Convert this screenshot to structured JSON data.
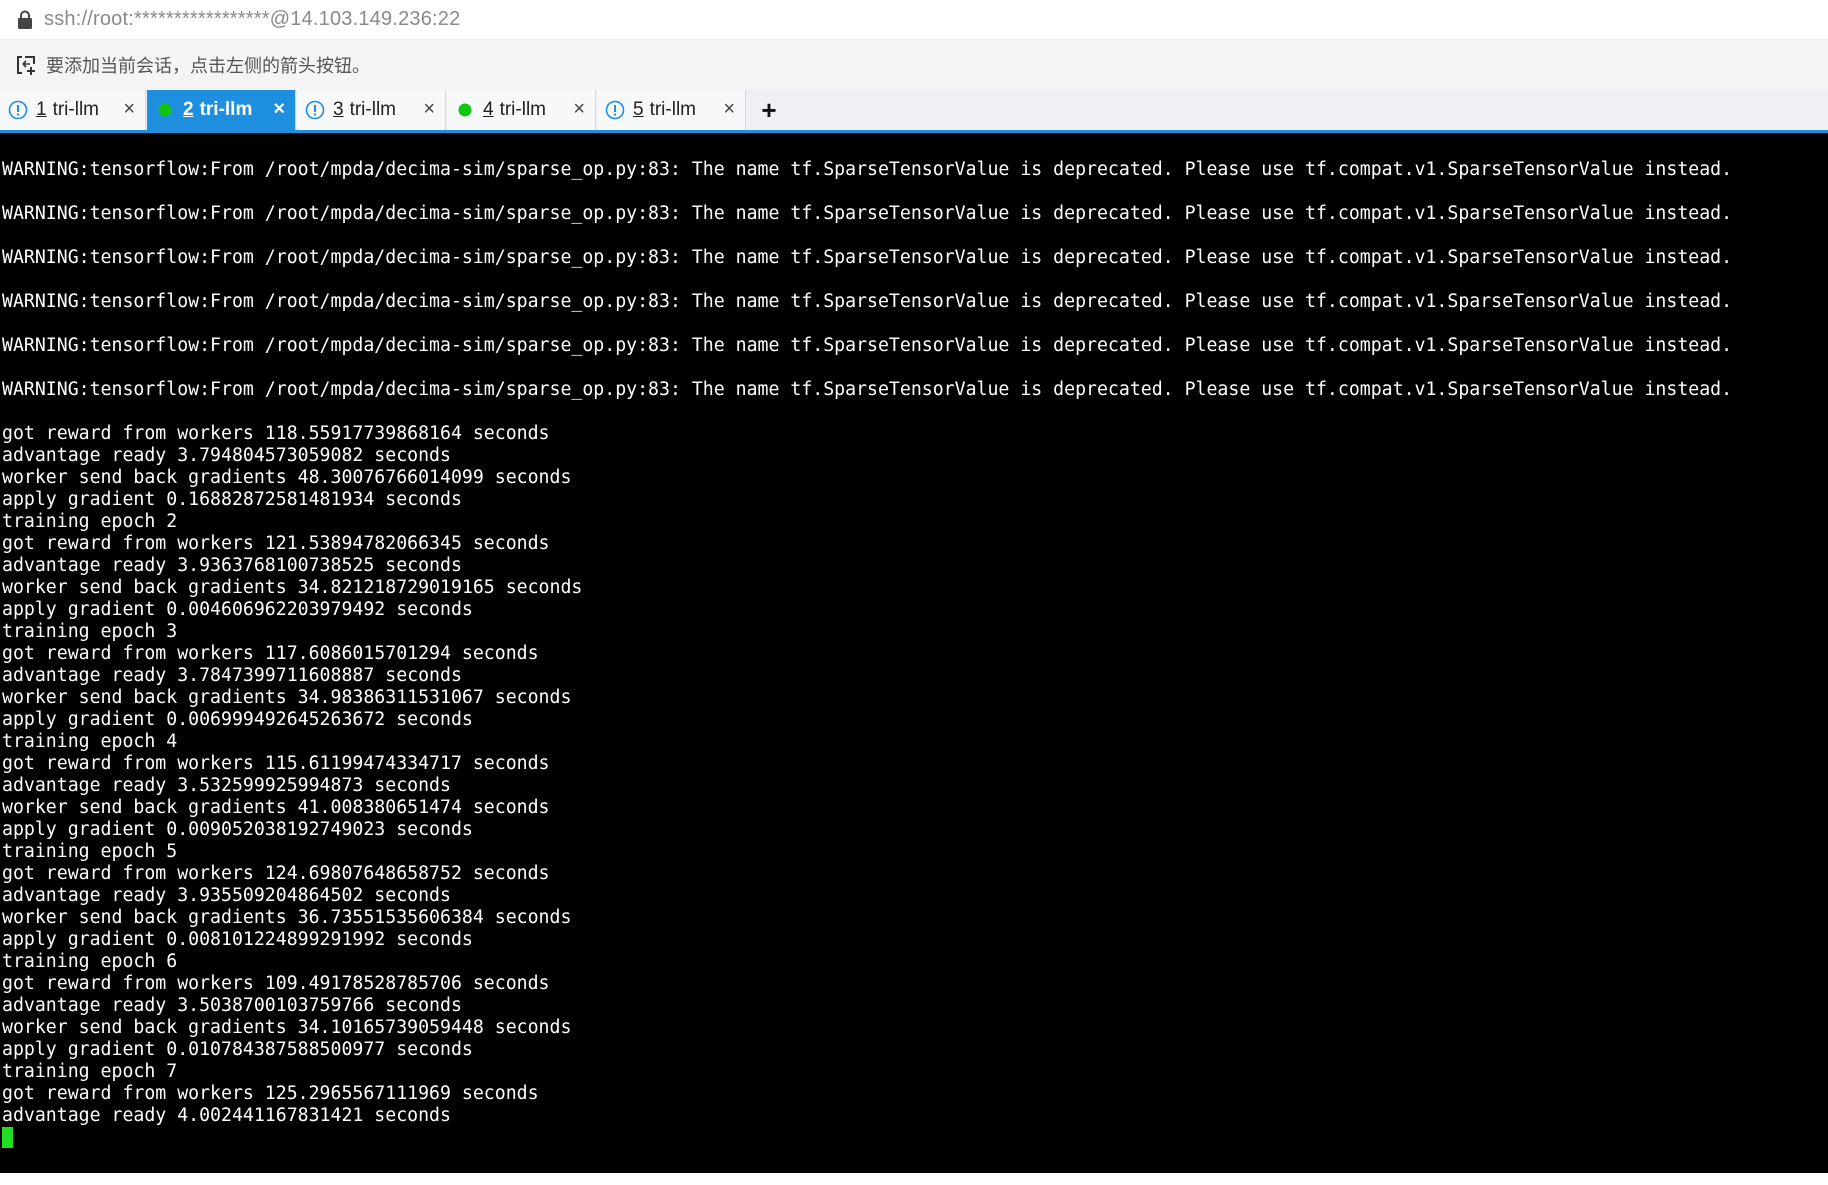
{
  "address": {
    "text": "ssh://root:*****************@14.103.149.236:22",
    "lock_icon": "lock-icon"
  },
  "hint": {
    "text": "要添加当前会话，点击左侧的箭头按钮。",
    "icon": "add-session-icon"
  },
  "tabs": [
    {
      "num": "1",
      "name": "tri-llm",
      "status": "warning",
      "active": false
    },
    {
      "num": "2",
      "name": "tri-llm",
      "status": "connected",
      "active": true
    },
    {
      "num": "3",
      "name": "tri-llm",
      "status": "warning",
      "active": false
    },
    {
      "num": "4",
      "name": "tri-llm",
      "status": "connected",
      "active": false
    },
    {
      "num": "5",
      "name": "tri-llm",
      "status": "warning",
      "active": false
    }
  ],
  "tab_close": "×",
  "new_tab": "+",
  "colors": {
    "accent": "#1e8fde",
    "connected": "#11c411",
    "warning": "#1e8fde",
    "cursor": "#22dd22"
  },
  "terminal": {
    "warnings": [
      "WARNING:tensorflow:From /root/mpda/decima-sim/sparse_op.py:83: The name tf.SparseTensorValue is deprecated. Please use tf.compat.v1.SparseTensorValue instead.",
      "WARNING:tensorflow:From /root/mpda/decima-sim/sparse_op.py:83: The name tf.SparseTensorValue is deprecated. Please use tf.compat.v1.SparseTensorValue instead.",
      "WARNING:tensorflow:From /root/mpda/decima-sim/sparse_op.py:83: The name tf.SparseTensorValue is deprecated. Please use tf.compat.v1.SparseTensorValue instead.",
      "WARNING:tensorflow:From /root/mpda/decima-sim/sparse_op.py:83: The name tf.SparseTensorValue is deprecated. Please use tf.compat.v1.SparseTensorValue instead.",
      "WARNING:tensorflow:From /root/mpda/decima-sim/sparse_op.py:83: The name tf.SparseTensorValue is deprecated. Please use tf.compat.v1.SparseTensorValue instead.",
      "WARNING:tensorflow:From /root/mpda/decima-sim/sparse_op.py:83: The name tf.SparseTensorValue is deprecated. Please use tf.compat.v1.SparseTensorValue instead."
    ],
    "output": [
      "got reward from workers 118.55917739868164 seconds",
      "advantage ready 3.794804573059082 seconds",
      "worker send back gradients 48.30076766014099 seconds",
      "apply gradient 0.16882872581481934 seconds",
      "training epoch 2",
      "got reward from workers 121.53894782066345 seconds",
      "advantage ready 3.9363768100738525 seconds",
      "worker send back gradients 34.821218729019165 seconds",
      "apply gradient 0.004606962203979492 seconds",
      "training epoch 3",
      "got reward from workers 117.6086015701294 seconds",
      "advantage ready 3.7847399711608887 seconds",
      "worker send back gradients 34.98386311531067 seconds",
      "apply gradient 0.006999492645263672 seconds",
      "training epoch 4",
      "got reward from workers 115.61199474334717 seconds",
      "advantage ready 3.532599925994873 seconds",
      "worker send back gradients 41.008380651474 seconds",
      "apply gradient 0.009052038192749023 seconds",
      "training epoch 5",
      "got reward from workers 124.69807648658752 seconds",
      "advantage ready 3.935509204864502 seconds",
      "worker send back gradients 36.73551535606384 seconds",
      "apply gradient 0.008101224899291992 seconds",
      "training epoch 6",
      "got reward from workers 109.49178528785706 seconds",
      "advantage ready 3.5038700103759766 seconds",
      "worker send back gradients 34.10165739059448 seconds",
      "apply gradient 0.010784387588500977 seconds",
      "training epoch 7",
      "got reward from workers 125.2965567111969 seconds",
      "advantage ready 4.002441167831421 seconds"
    ]
  }
}
